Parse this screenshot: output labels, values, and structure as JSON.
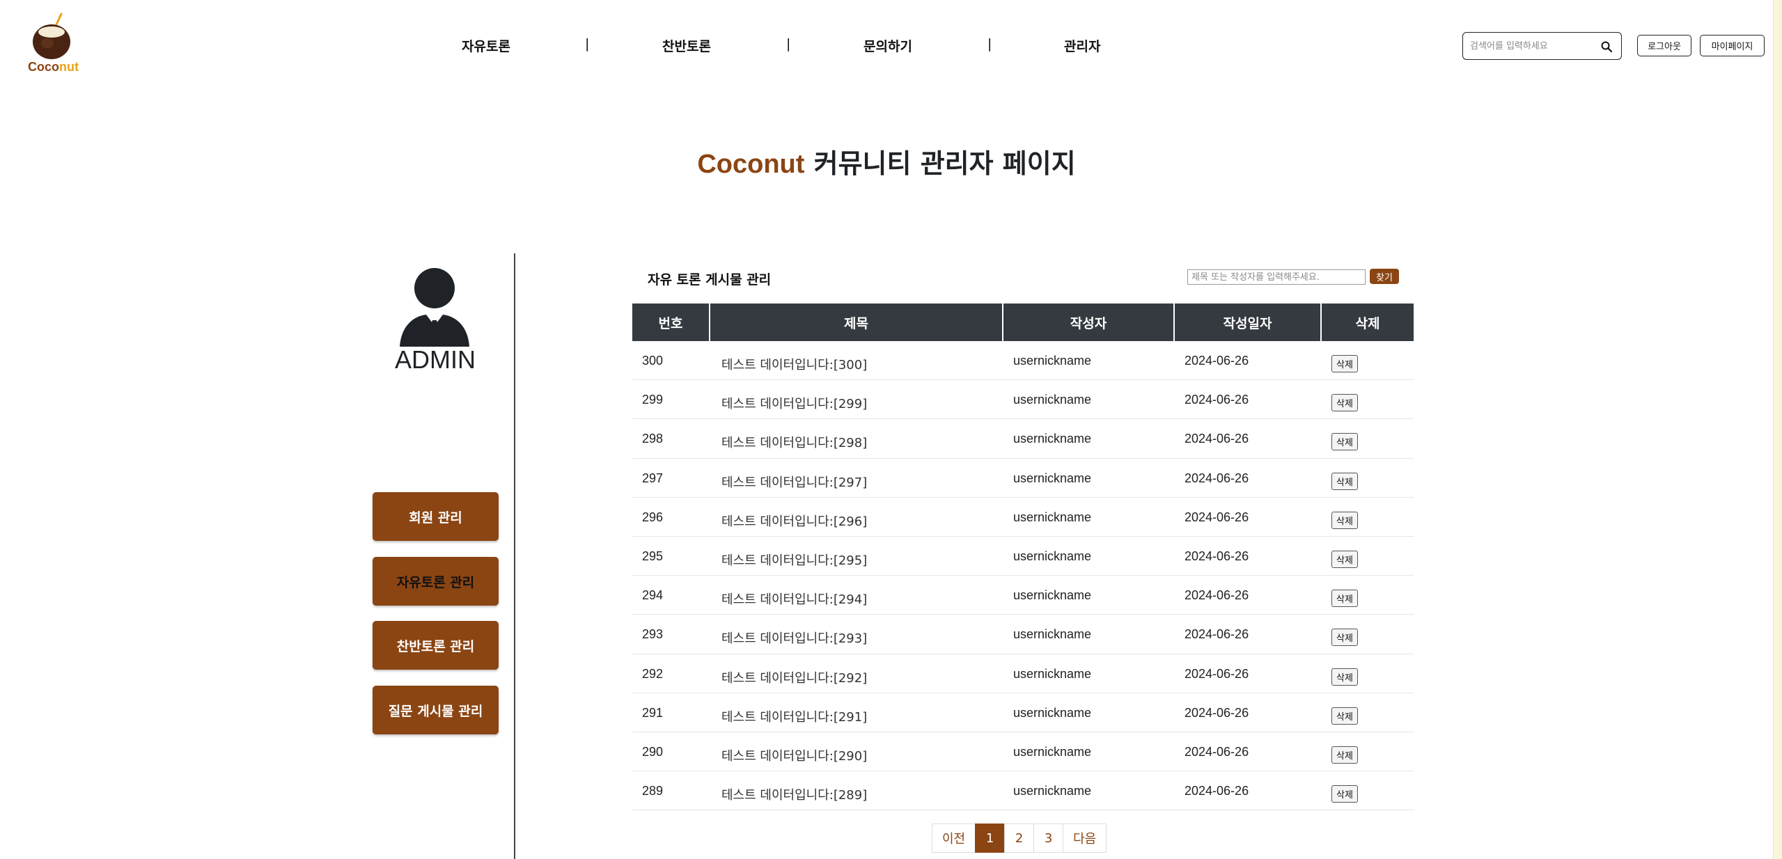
{
  "header": {
    "logo_text_a": "Coco",
    "logo_text_b": "nut",
    "nav": [
      {
        "label": "자유토론"
      },
      {
        "label": "찬반토론"
      },
      {
        "label": "문의하기"
      },
      {
        "label": "관리자"
      }
    ],
    "nav_separator": "|",
    "search_placeholder": "검색어를 입력하세요",
    "logout_label": "로그아웃",
    "mypage_label": "마이페이지"
  },
  "page_title": {
    "brand": "Coconut",
    "rest": " 커뮤니티 관리자 페이지"
  },
  "sidebar": {
    "admin_label": "ADMIN",
    "buttons": [
      {
        "label": "회원 관리"
      },
      {
        "label": "자유토론 관리"
      },
      {
        "label": "찬반토론 관리"
      },
      {
        "label": "질문 게시물 관리"
      }
    ]
  },
  "board": {
    "title": "자유 토론 게시물 관리",
    "search_placeholder": "제목 또는 작성자를 입력해주세요.",
    "find_label": "찾기",
    "columns": [
      "번호",
      "제목",
      "작성자",
      "작성일자",
      "삭제"
    ],
    "delete_label": "삭제",
    "rows": [
      {
        "no": "300",
        "title": "테스트 데이터입니다:[300]",
        "writer": "usernickname",
        "date": "2024-06-26"
      },
      {
        "no": "299",
        "title": "테스트 데이터입니다:[299]",
        "writer": "usernickname",
        "date": "2024-06-26"
      },
      {
        "no": "298",
        "title": "테스트 데이터입니다:[298]",
        "writer": "usernickname",
        "date": "2024-06-26"
      },
      {
        "no": "297",
        "title": "테스트 데이터입니다:[297]",
        "writer": "usernickname",
        "date": "2024-06-26"
      },
      {
        "no": "296",
        "title": "테스트 데이터입니다:[296]",
        "writer": "usernickname",
        "date": "2024-06-26"
      },
      {
        "no": "295",
        "title": "테스트 데이터입니다:[295]",
        "writer": "usernickname",
        "date": "2024-06-26"
      },
      {
        "no": "294",
        "title": "테스트 데이터입니다:[294]",
        "writer": "usernickname",
        "date": "2024-06-26"
      },
      {
        "no": "293",
        "title": "테스트 데이터입니다:[293]",
        "writer": "usernickname",
        "date": "2024-06-26"
      },
      {
        "no": "292",
        "title": "테스트 데이터입니다:[292]",
        "writer": "usernickname",
        "date": "2024-06-26"
      },
      {
        "no": "291",
        "title": "테스트 데이터입니다:[291]",
        "writer": "usernickname",
        "date": "2024-06-26"
      },
      {
        "no": "290",
        "title": "테스트 데이터입니다:[290]",
        "writer": "usernickname",
        "date": "2024-06-26"
      },
      {
        "no": "289",
        "title": "테스트 데이터입니다:[289]",
        "writer": "usernickname",
        "date": "2024-06-26"
      }
    ]
  },
  "pagination": {
    "prev_label": "이전",
    "pages": [
      "1",
      "2",
      "3"
    ],
    "current": "1",
    "next_label": "다음"
  },
  "colors": {
    "brand": "#8b4513",
    "accent": "#e8a317",
    "table_header": "#343a40"
  }
}
